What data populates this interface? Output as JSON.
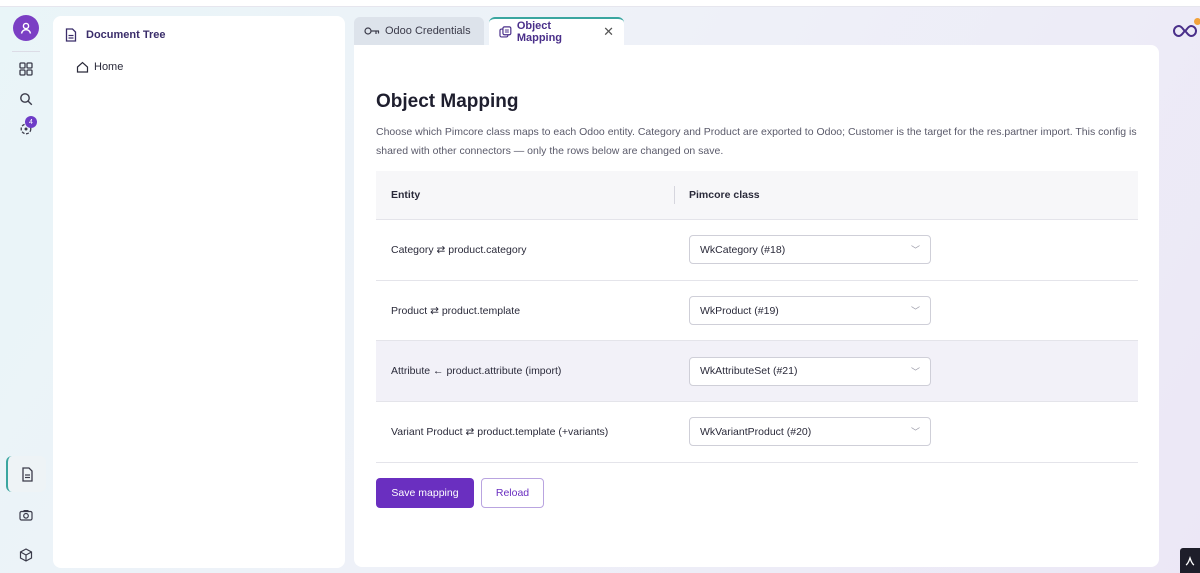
{
  "tree": {
    "title": "Document Tree",
    "home_label": "Home"
  },
  "rail": {
    "notifications_count": "4"
  },
  "tabs": [
    {
      "label": "Odoo Credentials",
      "active": false
    },
    {
      "label": "Object Mapping",
      "active": true
    }
  ],
  "main": {
    "title": "Object Mapping",
    "description": "Choose which Pimcore class maps to each Odoo entity. Category and Product are exported to Odoo; Customer is the target for the res.partner import. This config is shared with other connectors — only the rows below are changed on save.",
    "columns": {
      "entity": "Entity",
      "pimcore_class": "Pimcore class"
    },
    "rows": [
      {
        "entity": "Category ⇄ product.category",
        "pimcore_class": "WkCategory (#18)"
      },
      {
        "entity": "Product ⇄ product.template",
        "pimcore_class": "WkProduct (#19)"
      },
      {
        "entity": "Attribute ← product.attribute (import)",
        "pimcore_class": "WkAttributeSet (#21)"
      },
      {
        "entity": "Variant Product ⇄ product.template (+variants)",
        "pimcore_class": "WkVariantProduct (#20)"
      }
    ],
    "save_label": "Save mapping",
    "reload_label": "Reload"
  },
  "colors": {
    "accent": "#6a2fc0",
    "tab_indicator": "#3aa6a0",
    "logo_dot": "#f2a23a"
  }
}
